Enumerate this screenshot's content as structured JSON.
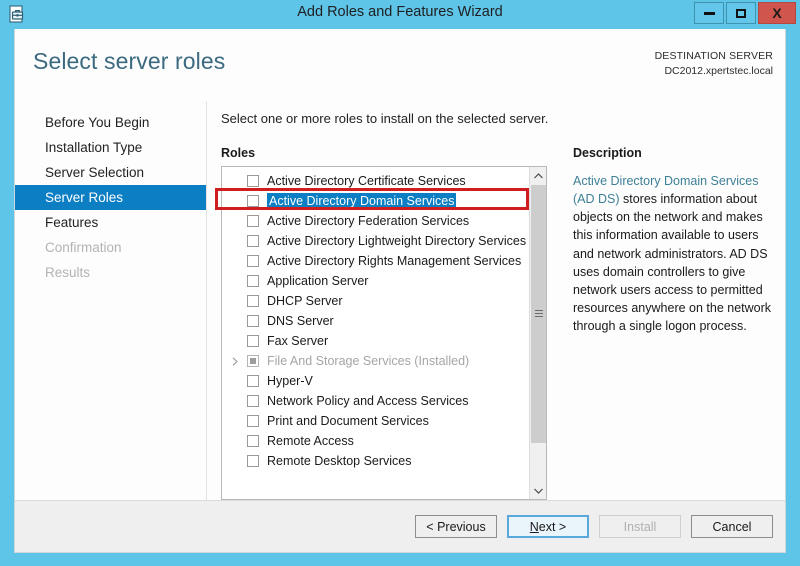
{
  "window": {
    "title": "Add Roles and Features Wizard",
    "icon": "server-wizard-icon",
    "controls": {
      "minimize": "minimize-button",
      "maximize": "maximize-button",
      "close_label": "X"
    },
    "accent_color": "#5ec4e8"
  },
  "header": {
    "page_title": "Select server roles",
    "destination_label": "DESTINATION SERVER",
    "destination_server": "DC2012.xpertstec.local"
  },
  "sidebar": {
    "items": [
      {
        "label": "Before You Begin",
        "state": "normal"
      },
      {
        "label": "Installation Type",
        "state": "normal"
      },
      {
        "label": "Server Selection",
        "state": "normal"
      },
      {
        "label": "Server Roles",
        "state": "active"
      },
      {
        "label": "Features",
        "state": "normal"
      },
      {
        "label": "Confirmation",
        "state": "disabled"
      },
      {
        "label": "Results",
        "state": "disabled"
      }
    ],
    "active_color": "#0b7ec4"
  },
  "content": {
    "instruction": "Select one or more roles to install on the selected server.",
    "roles_label": "Roles",
    "roles": [
      {
        "label": "Active Directory Certificate Services",
        "checked": false,
        "selected": false,
        "installed": false,
        "expandable": false
      },
      {
        "label": "Active Directory Domain Services",
        "checked": false,
        "selected": true,
        "installed": false,
        "expandable": false
      },
      {
        "label": "Active Directory Federation Services",
        "checked": false,
        "selected": false,
        "installed": false,
        "expandable": false
      },
      {
        "label": "Active Directory Lightweight Directory Services",
        "checked": false,
        "selected": false,
        "installed": false,
        "expandable": false
      },
      {
        "label": "Active Directory Rights Management Services",
        "checked": false,
        "selected": false,
        "installed": false,
        "expandable": false
      },
      {
        "label": "Application Server",
        "checked": false,
        "selected": false,
        "installed": false,
        "expandable": false
      },
      {
        "label": "DHCP Server",
        "checked": false,
        "selected": false,
        "installed": false,
        "expandable": false
      },
      {
        "label": "DNS Server",
        "checked": false,
        "selected": false,
        "installed": false,
        "expandable": false
      },
      {
        "label": "Fax Server",
        "checked": false,
        "selected": false,
        "installed": false,
        "expandable": false
      },
      {
        "label": "File And Storage Services (Installed)",
        "checked": true,
        "selected": false,
        "installed": true,
        "expandable": true
      },
      {
        "label": "Hyper-V",
        "checked": false,
        "selected": false,
        "installed": false,
        "expandable": false
      },
      {
        "label": "Network Policy and Access Services",
        "checked": false,
        "selected": false,
        "installed": false,
        "expandable": false
      },
      {
        "label": "Print and Document Services",
        "checked": false,
        "selected": false,
        "installed": false,
        "expandable": false
      },
      {
        "label": "Remote Access",
        "checked": false,
        "selected": false,
        "installed": false,
        "expandable": false
      },
      {
        "label": "Remote Desktop Services",
        "checked": false,
        "selected": false,
        "installed": false,
        "expandable": false
      }
    ],
    "annotation": {
      "color": "#d01e20",
      "target": "Active Directory Domain Services"
    }
  },
  "description": {
    "title": "Description",
    "lead_text": "Active Directory Domain Services (AD DS)",
    "rest_text": " stores information about objects on the network and makes this information available to users and network administrators. AD DS uses domain controllers to give network users access to permitted resources anywhere on the network through a single logon process.",
    "lead_color": "#3d7f97"
  },
  "footer": {
    "previous_label": "< Previous",
    "next_label_pre": "",
    "next_label_key": "N",
    "next_label_post": "ext >",
    "install_label": "Install",
    "cancel_label": "Cancel"
  }
}
